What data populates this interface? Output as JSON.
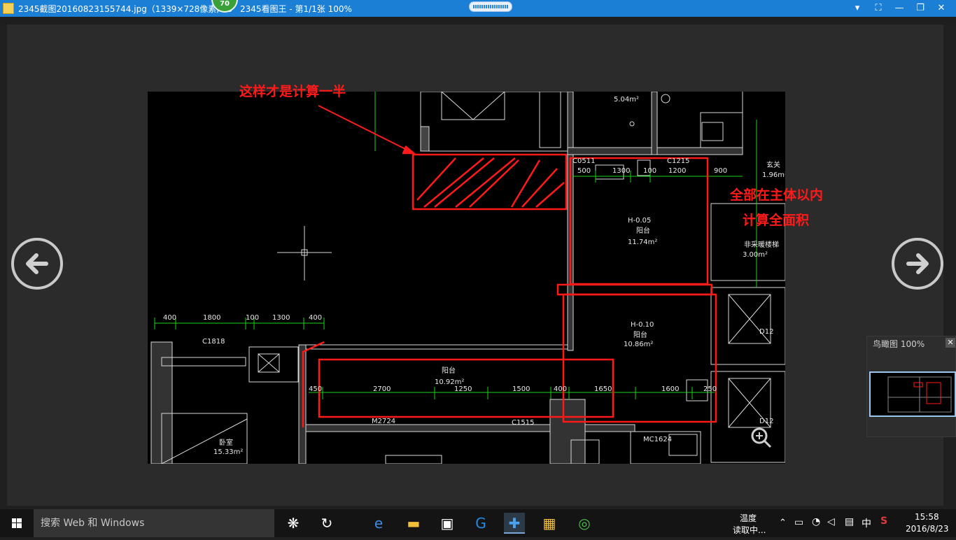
{
  "window": {
    "title": "2345截图20160823155744.jpg（1339×728像素, 75",
    "title_suffix": "2345看图王 - 第1/1张 100%",
    "badge": "70"
  },
  "annotations": {
    "half": "这样才是计算一半",
    "full_line1": "全部在主体以内",
    "full_line2": "计算全面积"
  },
  "drawing": {
    "room_labels": [
      {
        "name": "阳台",
        "area": "11.74m²",
        "elevation": "H-0.05"
      },
      {
        "name": "阳台",
        "area": "10.86m²",
        "elevation": "H-0.10"
      },
      {
        "name": "阳台",
        "area": "10.92m²"
      },
      {
        "name": "卧室",
        "area": "15.33m²"
      },
      {
        "name": "玄关",
        "area": "1.96m²"
      },
      {
        "name": "非采暖楼梯",
        "area": "3.00m²"
      }
    ],
    "other_texts": [
      "5.04m²",
      "C0511",
      "C1215",
      "C1818",
      "M2724",
      "C1515",
      "MC1624",
      "D12"
    ],
    "dims_top": [
      "400",
      "1800",
      "100",
      "1300",
      "400"
    ],
    "dims_mid": [
      "500",
      "1300",
      "100",
      "1200",
      "900"
    ],
    "dims_bottom": [
      "450",
      "2700",
      "1250",
      "1500",
      "400",
      "1650",
      "1600",
      "250"
    ]
  },
  "navigator": {
    "label": "鸟瞰图 100%",
    "close": "✕"
  },
  "taskbar": {
    "search_placeholder": "搜索 Web 和 Windows",
    "weather_line1": "温度",
    "weather_line2": "读取中...",
    "ime": "中",
    "time": "15:58",
    "date": "2016/8/23"
  }
}
